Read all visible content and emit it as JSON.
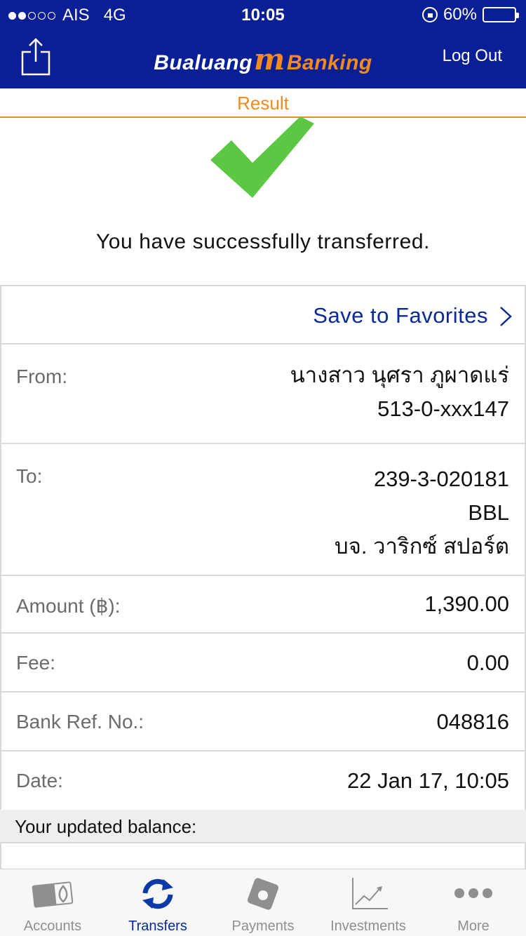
{
  "status_bar": {
    "carrier": "AIS",
    "network": "4G",
    "time": "10:05",
    "battery": "60%",
    "battery_level": 0.6
  },
  "header": {
    "brand_left": "Bualuang",
    "brand_mark": "m",
    "brand_right": "Banking",
    "logout_label": "Log Out",
    "colors": {
      "bar": "#0a1e96",
      "accent": "#f28a1e"
    }
  },
  "result_bar": {
    "label": "Result"
  },
  "message": "You have successfully transferred.",
  "favorites": {
    "label": "Save to Favorites"
  },
  "details": {
    "from": {
      "label": "From:",
      "name": "นางสาว นุศรา ภูผาดแร่",
      "account": "513-0-xxx147"
    },
    "to": {
      "label": "To:",
      "account": "239-3-020181",
      "bank": "BBL",
      "name": "บจ. วาริกซ์ สปอร์ต"
    },
    "amount": {
      "label": "Amount (฿):",
      "value": "1,390.00"
    },
    "fee": {
      "label": "Fee:",
      "value": "0.00"
    },
    "ref": {
      "label": "Bank Ref. No.:",
      "value": "048816"
    },
    "date": {
      "label": "Date:",
      "value": "22 Jan 17, 10:05"
    }
  },
  "balance": {
    "label": "Your updated balance:"
  },
  "tabs": [
    {
      "label": "Accounts",
      "icon": "accounts-icon",
      "active": false
    },
    {
      "label": "Transfers",
      "icon": "transfers-icon",
      "active": true
    },
    {
      "label": "Payments",
      "icon": "payments-icon",
      "active": false
    },
    {
      "label": "Investments",
      "icon": "investments-icon",
      "active": false
    },
    {
      "label": "More",
      "icon": "more-icon",
      "active": false
    }
  ]
}
